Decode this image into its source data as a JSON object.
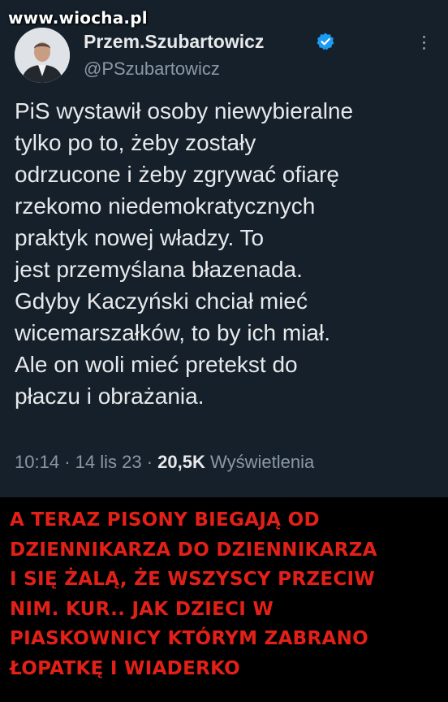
{
  "watermark": "www.wiocha.pl",
  "tweet": {
    "display_name": "Przem.Szubartowicz",
    "handle": "@PSzubartowicz",
    "text_lines": [
      "PiS wystawił osoby niewybieralne",
      "tylko po to, żeby zostały",
      "odrzucone i żeby zgrywać ofiarę",
      "rzekomo niedemokratycznych",
      "praktyk nowej władzy. To",
      "jest przemyślana błazenada.",
      "Gdyby Kaczyński chciał mieć",
      "wicemarszałków, to by ich miał.",
      "Ale on woli mieć pretekst do",
      "płaczu i obrażania."
    ],
    "time": "10:14",
    "date": "14 lis 23",
    "views_count": "20,5K",
    "views_label": "Wyświetlenia",
    "separator": "·"
  },
  "caption": {
    "lines": [
      "A TERAZ PISONY BIEGAJĄ OD",
      "DZIENNIKARZA DO DZIENNIKARZA",
      "I SIĘ ŻALĄ, ŻE WSZYSCY PRZECIW",
      "NIM. KUR.. JAK DZIECI W",
      "PIASKOWNICY KTÓRYM ZABRANO",
      "ŁOPATKĘ I WIADERKO"
    ]
  },
  "colors": {
    "tweet_bg": "#15202b",
    "text": "#e7e9ea",
    "muted": "#8b98a5",
    "verified": "#1d9bf0",
    "caption": "#e32018",
    "page_bg": "#000000"
  },
  "icons": [
    "verified-badge-icon",
    "more-options-icon",
    "avatar-photo"
  ]
}
